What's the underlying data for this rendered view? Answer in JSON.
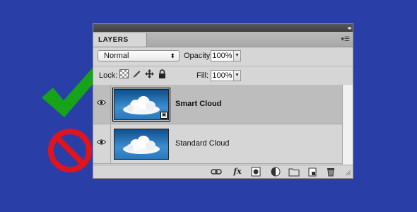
{
  "panel": {
    "tab_label": "LAYERS",
    "collapse_glyph": "◂◂",
    "menu_glyph": "▾☰"
  },
  "blend": {
    "mode": "Normal",
    "arrow": "⬍"
  },
  "opacity": {
    "label": "Opacity:",
    "value": "100%"
  },
  "lock": {
    "label": "Lock:"
  },
  "fill": {
    "label": "Fill:",
    "value": "100%"
  },
  "layers": [
    {
      "name": "Smart Cloud",
      "selected": true,
      "smart_object": true
    },
    {
      "name": "Standard Cloud",
      "selected": false,
      "smart_object": false
    }
  ],
  "bottom_icons": [
    "link-layers-icon",
    "fx-icon",
    "add-mask-icon",
    "adjustment-layer-icon",
    "new-group-icon",
    "new-layer-icon",
    "delete-layer-icon"
  ],
  "bottom_fx_label": "fx",
  "colors": {
    "background": "#2a3ea7",
    "check_green": "#16a31a",
    "no_red": "#e0141d",
    "panel": "#d6d6d6",
    "selected_row": "#bdbdbd"
  }
}
